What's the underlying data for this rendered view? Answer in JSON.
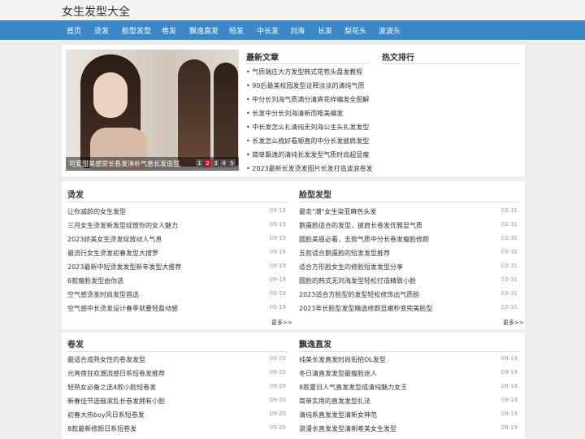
{
  "site": {
    "title": "女生发型大全"
  },
  "nav": [
    "首页",
    "烫发",
    "脸型发型",
    "卷发",
    "飘逸直发",
    "短发",
    "中长发",
    "刘海",
    "长发",
    "梨花头",
    "波波头"
  ],
  "slider": {
    "caption": "可爱甜美感觉长卷发淳朴气息长发造型",
    "pages": [
      "1",
      "2",
      "3",
      "4",
      "5"
    ],
    "active_page": 2
  },
  "latest": {
    "title": "最新文章",
    "items": [
      "气质端庄大方发型韩式花苞头盘发教程",
      "90后最美校园发型诠释淡淡的清纯气质",
      "中分长刘海气质满分清爽花样编发全图解",
      "长发中分长刘海清新而唯美编发",
      "中长发怎么扎清纯无刘海公主头扎发发型",
      "长发怎么梳好看顺直的中分长发披肩发型",
      "简单飘逸的清纯长发发型气质时尚超显瘦",
      "2023最新长发烫发图片长发打造波浪卷发时尚"
    ]
  },
  "hot": {
    "title": "热文排行"
  },
  "sections": {
    "perm": {
      "title": "烫发",
      "more": "更多>>",
      "items": [
        {
          "title": "让你减龄的女生发型",
          "date": "09-19"
        },
        {
          "title": "三月女生烫发新发型绽放你的女人魅力",
          "date": "09-19"
        },
        {
          "title": "2023娇美女生烫发绽放动人气息",
          "date": "09-19"
        },
        {
          "title": "最流行女生烫发初春发型大搜罗",
          "date": "09-19"
        },
        {
          "title": "2023最新中短烫发发型新年发型大推荐",
          "date": "09-19"
        },
        {
          "title": "6款瘦脸发型由你选",
          "date": "09-19"
        },
        {
          "title": "空气感烫发时尚发型首选",
          "date": "09-19"
        },
        {
          "title": "空气感中长烫发设计春季就要轻盈动感",
          "date": "09-19"
        }
      ]
    },
    "face": {
      "title": "脸型发型",
      "more": "更多>>",
      "items": [
        {
          "title": "最走\"潮\"女生染亚麻色头发",
          "date": "03-31"
        },
        {
          "title": "鹅蛋脸适合的发型，披肩长卷发优雅显气质",
          "date": "03-31"
        },
        {
          "title": "圆脸美眉必看，五款气质中分长卷发瘦脸修颜",
          "date": "03-31"
        },
        {
          "title": "五款适合鹅蛋脸的短发发型推荐",
          "date": "03-31"
        },
        {
          "title": "适合方形脸女生的修脸短发发型分享",
          "date": "03-31"
        },
        {
          "title": "圆脸的韩式无刘海发型轻松打造精致小脸",
          "date": "03-31"
        },
        {
          "title": "2023适合方脸型的发型轻松修饰出气质脸",
          "date": "03-31"
        },
        {
          "title": "2023年长脸型发型精选修颜显嫩秒变完美脸型",
          "date": "03-31"
        }
      ]
    },
    "curly": {
      "title": "卷发",
      "items": [
        {
          "title": "最适合成熟女性的卷发发型",
          "date": "09-20"
        },
        {
          "title": "元宵夜狂欢潮流感日系短卷发推荐",
          "date": "09-20"
        },
        {
          "title": "轻熟女必备之选4款小脸短卷发",
          "date": "09-20"
        },
        {
          "title": "新春佳节选俄滚乱长卷发拥有小脸",
          "date": "09-20"
        },
        {
          "title": "初春大热boy风日系短卷发",
          "date": "09-20"
        },
        {
          "title": "8款最新修颜日系短卷发",
          "date": "09-20"
        }
      ]
    },
    "straight": {
      "title": "飘逸直发",
      "items": [
        {
          "title": "纯美长发直发时尚街拍OL发型",
          "date": "09-19"
        },
        {
          "title": "冬日清直发发型最瘦脸迷人",
          "date": "09-19"
        },
        {
          "title": "8款夏日人气直发发型成清纯魅力女王",
          "date": "09-19"
        },
        {
          "title": "简单实用的直发发型扎法",
          "date": "09-19"
        },
        {
          "title": "清纯系直发发型清新女神范",
          "date": "09-19"
        },
        {
          "title": "浪漫长直发发型清新唯美女生发型",
          "date": "09-19"
        }
      ]
    }
  }
}
